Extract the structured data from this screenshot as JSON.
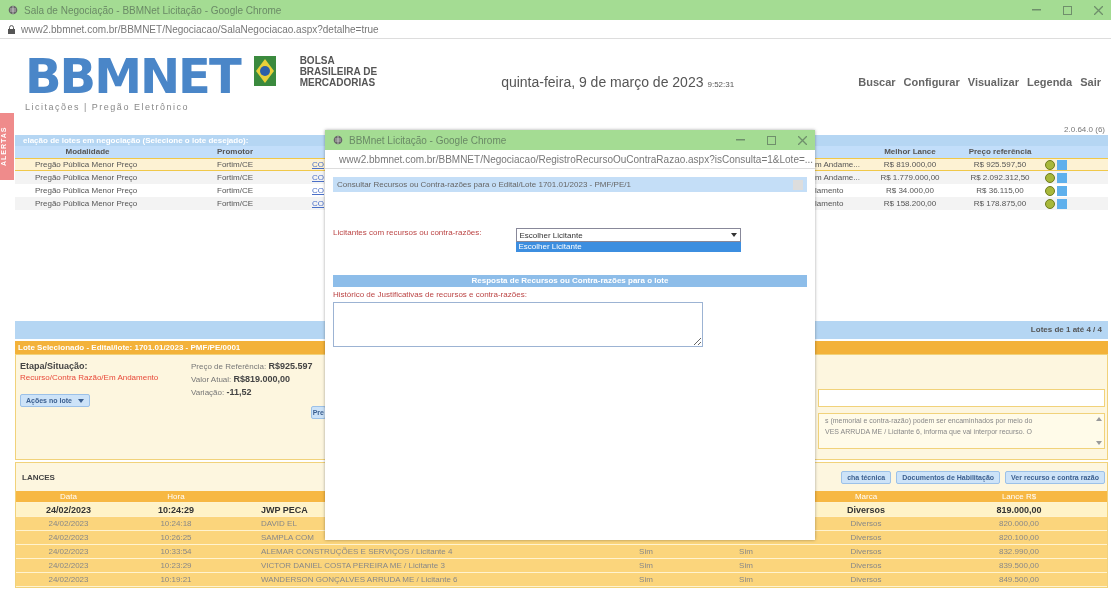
{
  "window": {
    "title": "Sala de Negociação - BBMNet Licitação - Google Chrome",
    "url": "www2.bbmnet.com.br/BBMNET/Negociacao/SalaNegociacao.aspx?detalhe=true"
  },
  "header": {
    "logo": "BBMNET",
    "tagline": "Licitações | Pregão Eletrônico",
    "partner": [
      "BOLSA",
      "BRASILEIRA DE",
      "MERCADORIAS"
    ],
    "date": "quinta-feira, 9 de março de 2023",
    "time": "9:52:31",
    "nav": [
      "Buscar",
      "Configurar",
      "Visualizar",
      "Legenda",
      "Sair"
    ]
  },
  "alerts_tab": "ALERTAS",
  "version": "2.0.64.0 (6)",
  "lots": {
    "title": "elação de lotes em negociação (Selecione o lote desejado):",
    "columns": [
      "Modalidade",
      "Promotor",
      "Melhor Lance",
      "Preço referência"
    ],
    "rows": [
      {
        "modalidade": "Pregão Pública Menor Preço",
        "promotor": "Fortim/CE",
        "column_3": "CO",
        "column_4": "m Andame...",
        "melhor_lance": "R$ 819.000,00",
        "preco_referencia": "R$ 925.597,50",
        "selected": true
      },
      {
        "modalidade": "Pregão Pública Menor Preço",
        "promotor": "Fortim/CE",
        "column_3": "CO",
        "column_4": "m Andame...",
        "melhor_lance": "R$ 1.779.000,00",
        "preco_referencia": "R$ 2.092.312,50",
        "selected": false
      },
      {
        "modalidade": "Pregão Pública Menor Preço",
        "promotor": "Fortim/CE",
        "column_3": "CO",
        "column_4": "lamento",
        "melhor_lance": "R$ 34.000,00",
        "preco_referencia": "R$ 36.115,00",
        "selected": false
      },
      {
        "modalidade": "Pregão Pública Menor Preço",
        "promotor": "Fortim/CE",
        "column_3": "CO",
        "column_4": "lamento",
        "melhor_lance": "R$ 158.200,00",
        "preco_referencia": "R$ 178.875,00",
        "selected": false
      }
    ],
    "footer": "Lotes de 1 até 4 / 4"
  },
  "selected_lot": {
    "title": "Lote Selecionado - Edital/lote: 1701.01/2023 - PMF/PE/0001",
    "stage_label": "Etapa/Situação:",
    "stage": "Recurso/Contra Razão/Em Andamento",
    "fields": [
      {
        "label": "Preço de Referência:",
        "value": "R$925.597"
      },
      {
        "label": "Valor Atual:",
        "value": "R$819.000,00"
      },
      {
        "label": "Variação:",
        "value": "-11,52"
      }
    ],
    "actions_button": "Ações no lote",
    "cut_button": "Pre",
    "messages": [
      "s (memorial e contra-razão) podem ser encaminhados por meio do",
      "VES ARRUDA ME / Licitante 6, informa que vai interpor recurso. O"
    ]
  },
  "bids": {
    "title": "LANCES",
    "buttons": [
      "cha técnica",
      "Documentos de Habilitação",
      "Ver recurso e contra razão"
    ],
    "columns": [
      "Data",
      "Hora",
      "Marca",
      "Lance R$"
    ],
    "rows": [
      {
        "data": "24/02/2023",
        "hora": "10:24:29",
        "licitante": "JWP PECA",
        "marca": "Diversos",
        "lance": "819.000,00",
        "best": true
      },
      {
        "data": "24/02/2023",
        "hora": "10:24:18",
        "licitante": "DAVID EL",
        "marca": "Diversos",
        "lance": "820.000,00",
        "best": false
      },
      {
        "data": "24/02/2023",
        "hora": "10:26:25",
        "licitante": "SAMPLA COM",
        "marca": "Diversos",
        "lance": "820.100,00",
        "best": false
      },
      {
        "data": "24/02/2023",
        "hora": "10:33:54",
        "licitante": "ALEMAR CONSTRUÇÕES E SERVIÇOS / Licitante 4",
        "column_4": "Sim",
        "column_5": "Sim",
        "marca": "Diversos",
        "lance": "832.990,00",
        "best": false
      },
      {
        "data": "24/02/2023",
        "hora": "10:23:29",
        "licitante": "VICTOR DANIEL COSTA PEREIRA ME / Licitante 3",
        "column_4": "Sim",
        "column_5": "Sim",
        "marca": "Diversos",
        "lance": "839.500,00",
        "best": false
      },
      {
        "data": "24/02/2023",
        "hora": "10:19:21",
        "licitante": "WANDERSON GONÇALVES ARRUDA ME / Licitante 6",
        "column_4": "Sim",
        "column_5": "Sim",
        "marca": "Diversos",
        "lance": "849.500,00",
        "best": false
      }
    ]
  },
  "popup": {
    "title": "BBMnet Licitação - Google Chrome",
    "url": "www2.bbmnet.com.br/BBMNET/Negociacao/RegistroRecursoOuContraRazao.aspx?isConsulta=1&Lote=...",
    "heading": "Consultar Recursos ou Contra-razões para o Edital/Lote 1701.01/2023 - PMF/PE/1",
    "select_label": "Licitantes com recursos ou contra-razões:",
    "select_value": "Escolher Licitante",
    "options": [
      {
        "label": "Escolher Licitante",
        "selected": true
      }
    ],
    "section": "Resposta de Recursos ou Contra-razões para o lote",
    "history_label": "Histórico de Justificativas de recursos e contra-razões:"
  }
}
